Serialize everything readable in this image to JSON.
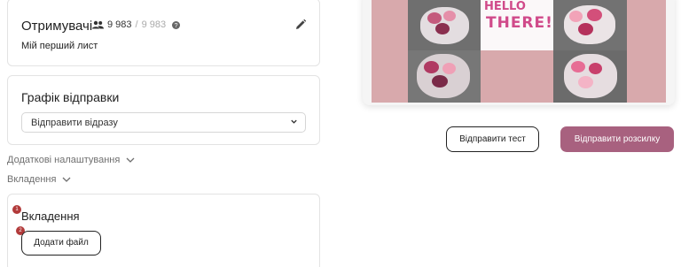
{
  "recipients": {
    "title": "Отримувачі",
    "active_count": "9 983",
    "separator": "/",
    "total_count": "9 983",
    "subtitle": "Мій перший лист"
  },
  "schedule": {
    "title": "Графік відправки",
    "selected": "Відправити відразу"
  },
  "collapsibles": {
    "advanced": "Додаткові налаштування",
    "attachments": "Вкладення"
  },
  "attachments": {
    "title": "Вкладення",
    "badge1": "1",
    "badge2": "2",
    "add_file": "Додати файл"
  },
  "preview": {
    "hello_line1": "HELLO",
    "hello_line2": "THERE!"
  },
  "actions": {
    "send_test": "Відправити тест",
    "send_campaign": "Відправити розсилку"
  },
  "colors": {
    "primary": "#a8617f",
    "badge": "#b23a3a",
    "preview_bg": "#d8a9ac"
  }
}
